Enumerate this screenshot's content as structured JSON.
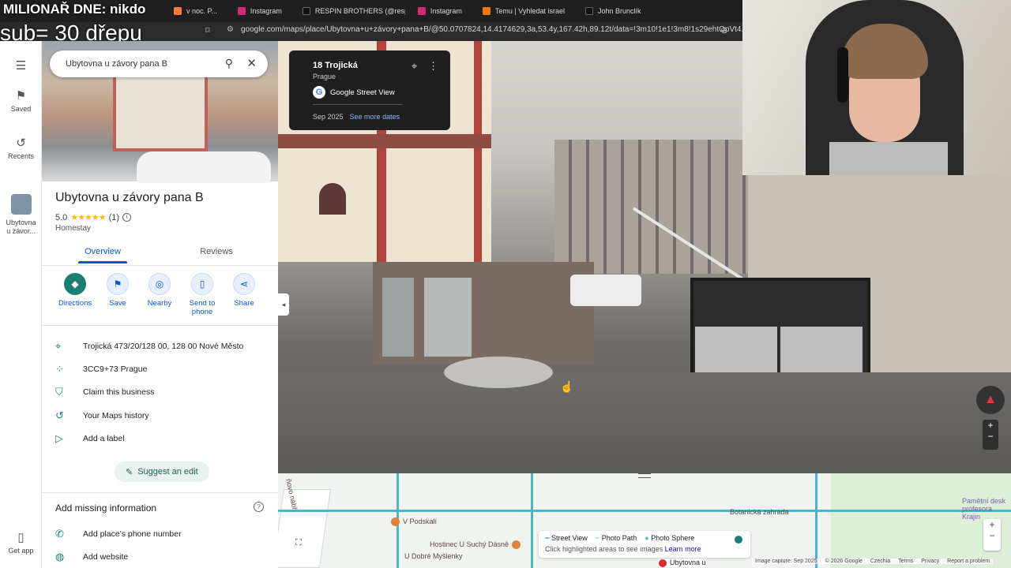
{
  "overlay": {
    "line1": "MILIONAŘ DNE: nikdo",
    "line2": "sub= 30 dřepu"
  },
  "browser": {
    "tabs": [
      {
        "label": "v noc. P...",
        "icon_color": "#ff7a3c"
      },
      {
        "label": "Instagram",
        "icon_color": "#d62976"
      },
      {
        "label": "RESPIN BROTHERS (@respinb...",
        "icon_color": "#111111"
      },
      {
        "label": "Instagram",
        "icon_color": "#d62976"
      },
      {
        "label": "Temu | Vyhledat israel",
        "icon_color": "#fb7701"
      },
      {
        "label": "John Brunclík",
        "icon_color": "#111111"
      }
    ],
    "url": "google.com/maps/place/Ubytovna+u+závory+pana+B/@50.0707824,14.4174629,3a,53.4y,167.42h,89.12t/data=!3m10!1e1!3m8!1s29ehtOpVt4..."
  },
  "rail": {
    "saved": "Saved",
    "recents": "Recents",
    "recent_place": "Ubytovna u závor...",
    "get_app": "Get app"
  },
  "panel": {
    "search_value": "Ubytovna u závory pana B",
    "title": "Ubytovna u závory pana B",
    "rating": "5.0",
    "stars": "★★★★★",
    "reviews_count": "(1)",
    "category": "Homestay",
    "tabs": {
      "overview": "Overview",
      "reviews": "Reviews"
    },
    "actions": {
      "directions": "Directions",
      "save": "Save",
      "nearby": "Nearby",
      "send": "Send to phone",
      "share": "Share"
    },
    "info": {
      "address": "Trojická 473/20/128 00, 128 00 Nové Město",
      "pluscode": "3CC9+73 Prague",
      "claim": "Claim this business",
      "history": "Your Maps history",
      "label": "Add a label"
    },
    "suggest": "Suggest an edit",
    "missing_title": "Add missing information",
    "missing": {
      "phone": "Add place's phone number",
      "website": "Add website"
    }
  },
  "streetview": {
    "card_title": "18 Trojická",
    "card_city": "Prague",
    "card_source": "Google Street View",
    "card_date": "Sep 2025",
    "card_more": "See more dates"
  },
  "map": {
    "labels": {
      "vpodskali": "V Podskalí",
      "hostinec": "Hostinec U Suchý Dásně",
      "udobre": "U Dobré Myšlenky",
      "botanicka": "Botanická zahrada",
      "pametni": "Pamětní desk profesora Krajin",
      "street": "ňovo nábř."
    },
    "legend": {
      "street_view": "Street View",
      "photo_path": "Photo Path",
      "photo_sphere": "Photo Sphere",
      "hint": "Click highlighted areas to see images",
      "learn_more": "Learn more"
    },
    "place_label": "Ubytovna u",
    "footer": {
      "capture": "Image capture: Sep 2025",
      "copyright": "© 2026 Google",
      "country": "Czechia",
      "terms": "Terms",
      "privacy": "Privacy",
      "report": "Report a problem"
    }
  },
  "colors": {
    "accent": "#0b57d0",
    "brand_teal": "#1a7f73",
    "star": "#fbbc04"
  }
}
